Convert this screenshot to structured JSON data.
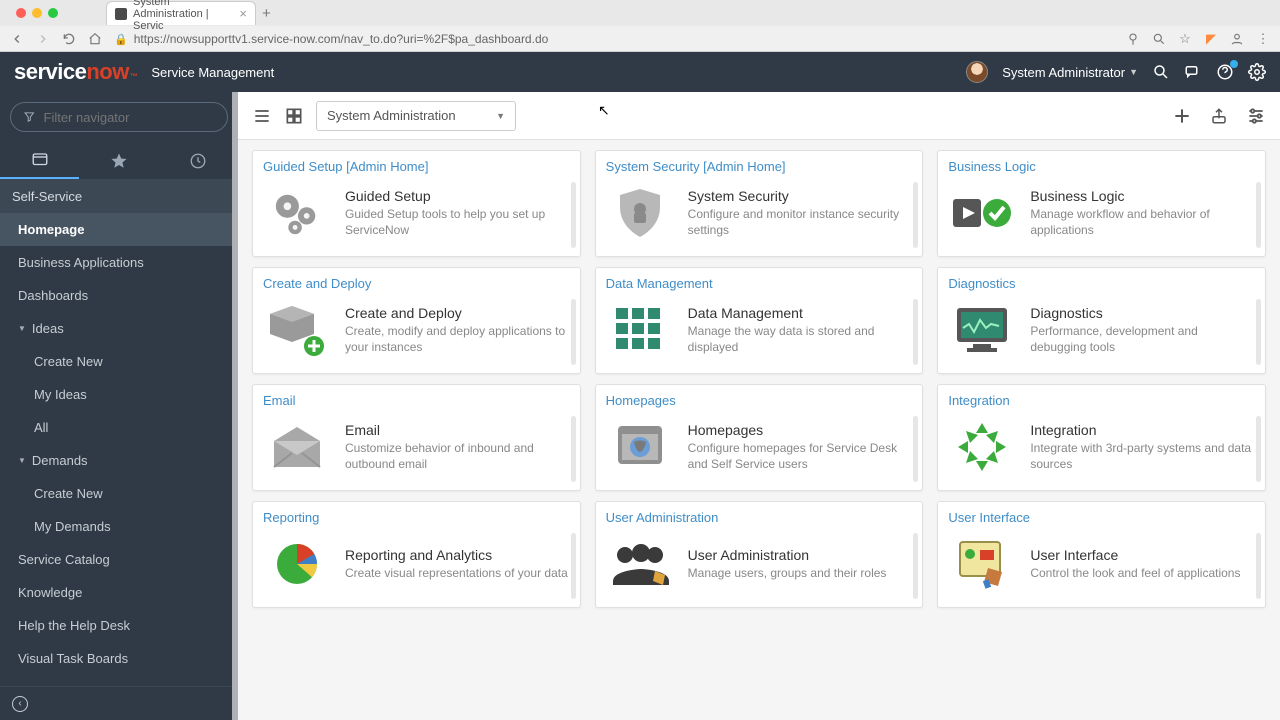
{
  "browser": {
    "tab_title": "System Administration | Servic",
    "url": "https://nowsupporttv1.service-now.com/nav_to.do?uri=%2F$pa_dashboard.do"
  },
  "header": {
    "logo_a": "service",
    "logo_b": "now",
    "logo_tm": "™",
    "app_title": "Service Management",
    "user_name": "System Administrator"
  },
  "sidebar": {
    "filter_placeholder": "Filter navigator",
    "section": "Self-Service",
    "items": [
      {
        "label": "Homepage",
        "active": true
      },
      {
        "label": "Business Applications"
      },
      {
        "label": "Dashboards"
      },
      {
        "label": "Ideas",
        "expandable": true,
        "children": [
          "Create New",
          "My Ideas",
          "All"
        ]
      },
      {
        "label": "Demands",
        "expandable": true,
        "children": [
          "Create New",
          "My Demands"
        ]
      },
      {
        "label": "Service Catalog"
      },
      {
        "label": "Knowledge"
      },
      {
        "label": "Help the Help Desk"
      },
      {
        "label": "Visual Task Boards"
      }
    ]
  },
  "toolbar": {
    "dropdown_value": "System Administration"
  },
  "cards": [
    {
      "header": "Guided Setup [Admin Home]",
      "title": "Guided Setup",
      "desc": "Guided Setup tools to help you set up ServiceNow",
      "icon": "gears"
    },
    {
      "header": "System Security [Admin Home]",
      "title": "System Security",
      "desc": "Configure and monitor instance security settings",
      "icon": "shield"
    },
    {
      "header": "Business Logic",
      "title": "Business Logic",
      "desc": "Manage workflow and behavior of applications",
      "icon": "playcheck"
    },
    {
      "header": "Create and Deploy",
      "title": "Create and Deploy",
      "desc": "Create, modify and deploy applications to your instances",
      "icon": "block"
    },
    {
      "header": "Data Management",
      "title": "Data Management",
      "desc": "Manage the way data is stored and displayed",
      "icon": "grid"
    },
    {
      "header": "Diagnostics",
      "title": "Diagnostics",
      "desc": "Performance, development and debugging tools",
      "icon": "monitor"
    },
    {
      "header": "Email",
      "title": "Email",
      "desc": "Customize behavior of inbound and outbound email",
      "icon": "envelope"
    },
    {
      "header": "Homepages",
      "title": "Homepages",
      "desc": "Configure homepages for Service Desk and Self Service users",
      "icon": "globe"
    },
    {
      "header": "Integration",
      "title": "Integration",
      "desc": "Integrate with 3rd-party systems and data sources",
      "icon": "arrows"
    },
    {
      "header": "Reporting",
      "title": "Reporting and Analytics",
      "desc": "Create visual representations of your data",
      "icon": "pie"
    },
    {
      "header": "User Administration",
      "title": "User Administration",
      "desc": "Manage users, groups and their roles",
      "icon": "users"
    },
    {
      "header": "User Interface",
      "title": "User Interface",
      "desc": "Control the look and feel of applications",
      "icon": "uitools"
    }
  ]
}
